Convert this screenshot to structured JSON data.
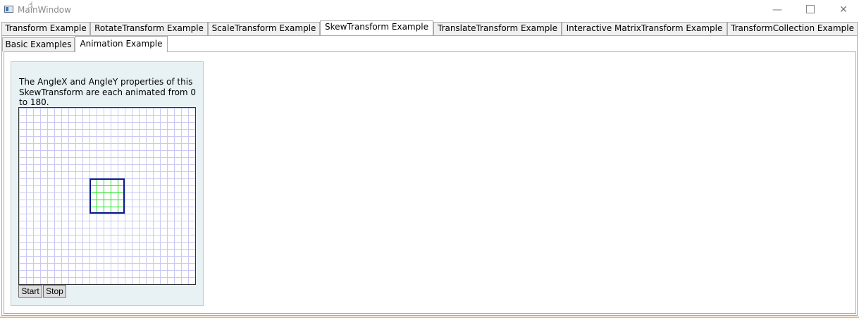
{
  "window": {
    "title": "MainWindow",
    "minimize_glyph": "—",
    "close_glyph": "✕"
  },
  "top_tabs": [
    {
      "label": "Transform Example",
      "selected": false
    },
    {
      "label": "RotateTransform Example",
      "selected": false
    },
    {
      "label": "ScaleTransform Example",
      "selected": false
    },
    {
      "label": "SkewTransform Example",
      "selected": true
    },
    {
      "label": "TranslateTransform Example",
      "selected": false
    },
    {
      "label": "Interactive MatrixTransform Example",
      "selected": false
    },
    {
      "label": "TransformCollection Example",
      "selected": false
    }
  ],
  "inner_tabs": [
    {
      "label": "Basic Examples",
      "selected": false
    },
    {
      "label": "Animation Example",
      "selected": true
    }
  ],
  "panel": {
    "description": "The AngleX and AngleY properties of this SkewTransform are each animated from 0 to 180.",
    "start_label": "Start",
    "stop_label": "Stop"
  },
  "colors": {
    "panel_background": "#e8f2f5",
    "grid_line": "#c9c9f2",
    "rect_border": "#0a1a8c",
    "rect_grid": "#22dd22",
    "tab_accent": "#e8b37a"
  }
}
